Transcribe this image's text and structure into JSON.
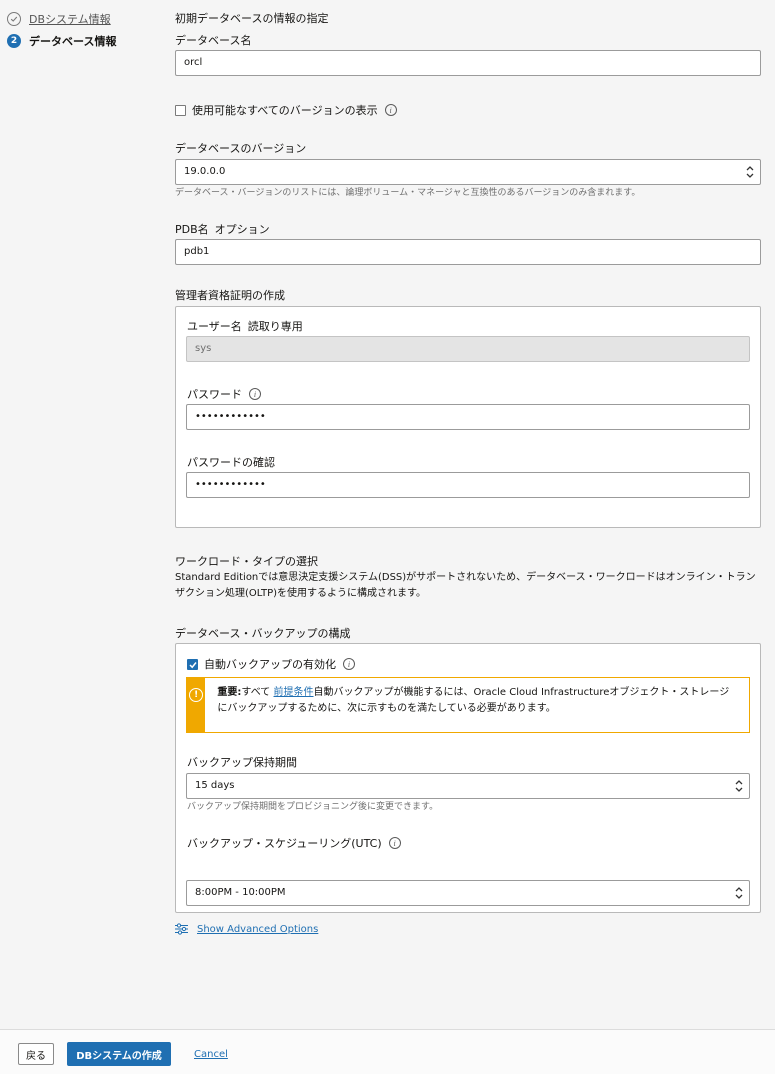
{
  "steps": [
    {
      "label": "DBシステム情報",
      "state": "done"
    },
    {
      "number": "2",
      "label": "データベース情報",
      "state": "current"
    }
  ],
  "form": {
    "section_title": "初期データベースの情報の指定",
    "db_name": {
      "label": "データベース名",
      "value": "orcl"
    },
    "show_all_versions": {
      "label": "使用可能なすべてのバージョンの表示",
      "checked": false
    },
    "db_version": {
      "label": "データベースのバージョン",
      "value": "19.0.0.0",
      "help": "データベース・バージョンのリストには、論理ボリューム・マネージャと互換性のあるバージョンのみ含まれます。"
    },
    "pdb_name": {
      "label": "PDB名",
      "optional": "オプション",
      "value": "pdb1"
    },
    "admin": {
      "title": "管理者資格証明の作成",
      "username_label": "ユーザー名",
      "username_note": "読取り専用",
      "username_value": "sys",
      "password_label": "パスワード",
      "password_value": "••••••••••••",
      "confirm_label": "パスワードの確認",
      "confirm_value": "••••••••••••"
    },
    "workload": {
      "title": "ワークロード・タイプの選択",
      "description": "Standard Editionでは意思決定支援システム(DSS)がサポートされないため、データベース・ワークロードはオンライン・トランザクション処理(OLTP)を使用するように構成されます。"
    },
    "backup": {
      "title": "データベース・バックアップの構成",
      "auto_backup_label": "自動バックアップの有効化",
      "auto_backup_checked": true,
      "warning_strong": "重要:",
      "warning_pre": "すべて ",
      "warning_link": "前提条件",
      "warning_post": "自動バックアップが機能するには、Oracle Cloud Infrastructureオブジェクト・ストレージにバックアップするために、次に示すものを満たしている必要があります。",
      "retention_label": "バックアップ保持期間",
      "retention_value": "15 days",
      "retention_help": "バックアップ保持期間をプロビジョニング後に変更できます。",
      "schedule_label": "バックアップ・スケジューリング(UTC)",
      "schedule_value": "8:00PM - 10:00PM"
    },
    "advanced_link": "Show Advanced Options"
  },
  "footer": {
    "back_label": "戻る",
    "create_label": "DBシステムの作成",
    "cancel_label": "Cancel"
  },
  "colors": {
    "primary": "#1f6fb2",
    "warning": "#f0a800"
  }
}
